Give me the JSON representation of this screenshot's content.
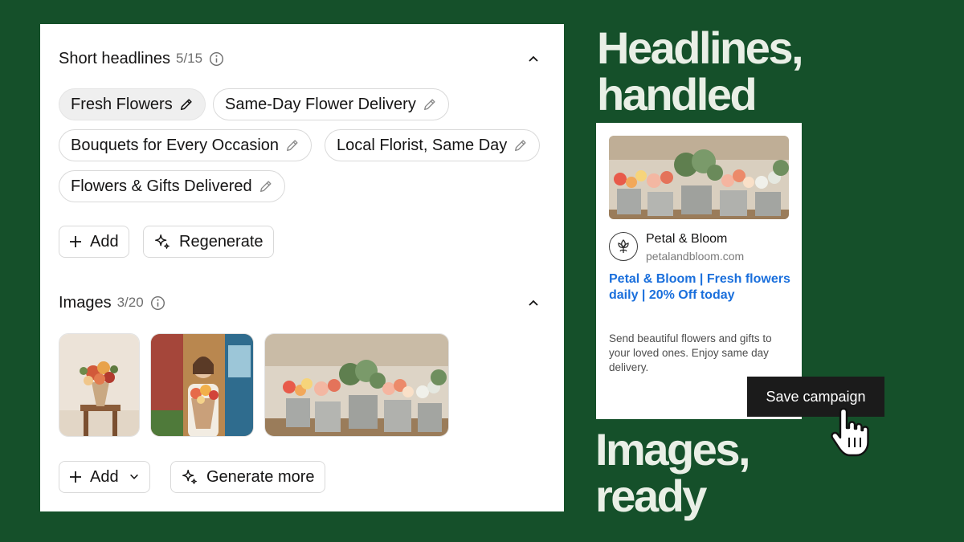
{
  "headlines_section": {
    "title": "Short headlines",
    "count": "5/15",
    "chips": [
      "Fresh Flowers",
      "Same-Day Flower Delivery",
      "Bouquets for Every Occasion",
      "Local Florist, Same Day",
      "Flowers & Gifts Delivered"
    ],
    "add_label": "Add",
    "regenerate_label": "Regenerate"
  },
  "images_section": {
    "title": "Images",
    "count": "3/20",
    "add_label": "Add",
    "generate_label": "Generate more"
  },
  "hero": {
    "headline_line1": "Headlines,",
    "headline_line2": "handled",
    "images_line1": "Images,",
    "images_line2": "ready"
  },
  "ad_preview": {
    "brand": "Petal & Bloom",
    "url": "petalandbloom.com",
    "headline": "Petal & Bloom | Fresh flowers daily | 20% Off today",
    "description": "Send beautiful flowers and gifts to your loved ones. Enjoy same day delivery."
  },
  "save_button_label": "Save campaign",
  "colors": {
    "background": "#15502a",
    "ad_headline": "#1a6fdc",
    "save_button": "#1b1b1b"
  }
}
